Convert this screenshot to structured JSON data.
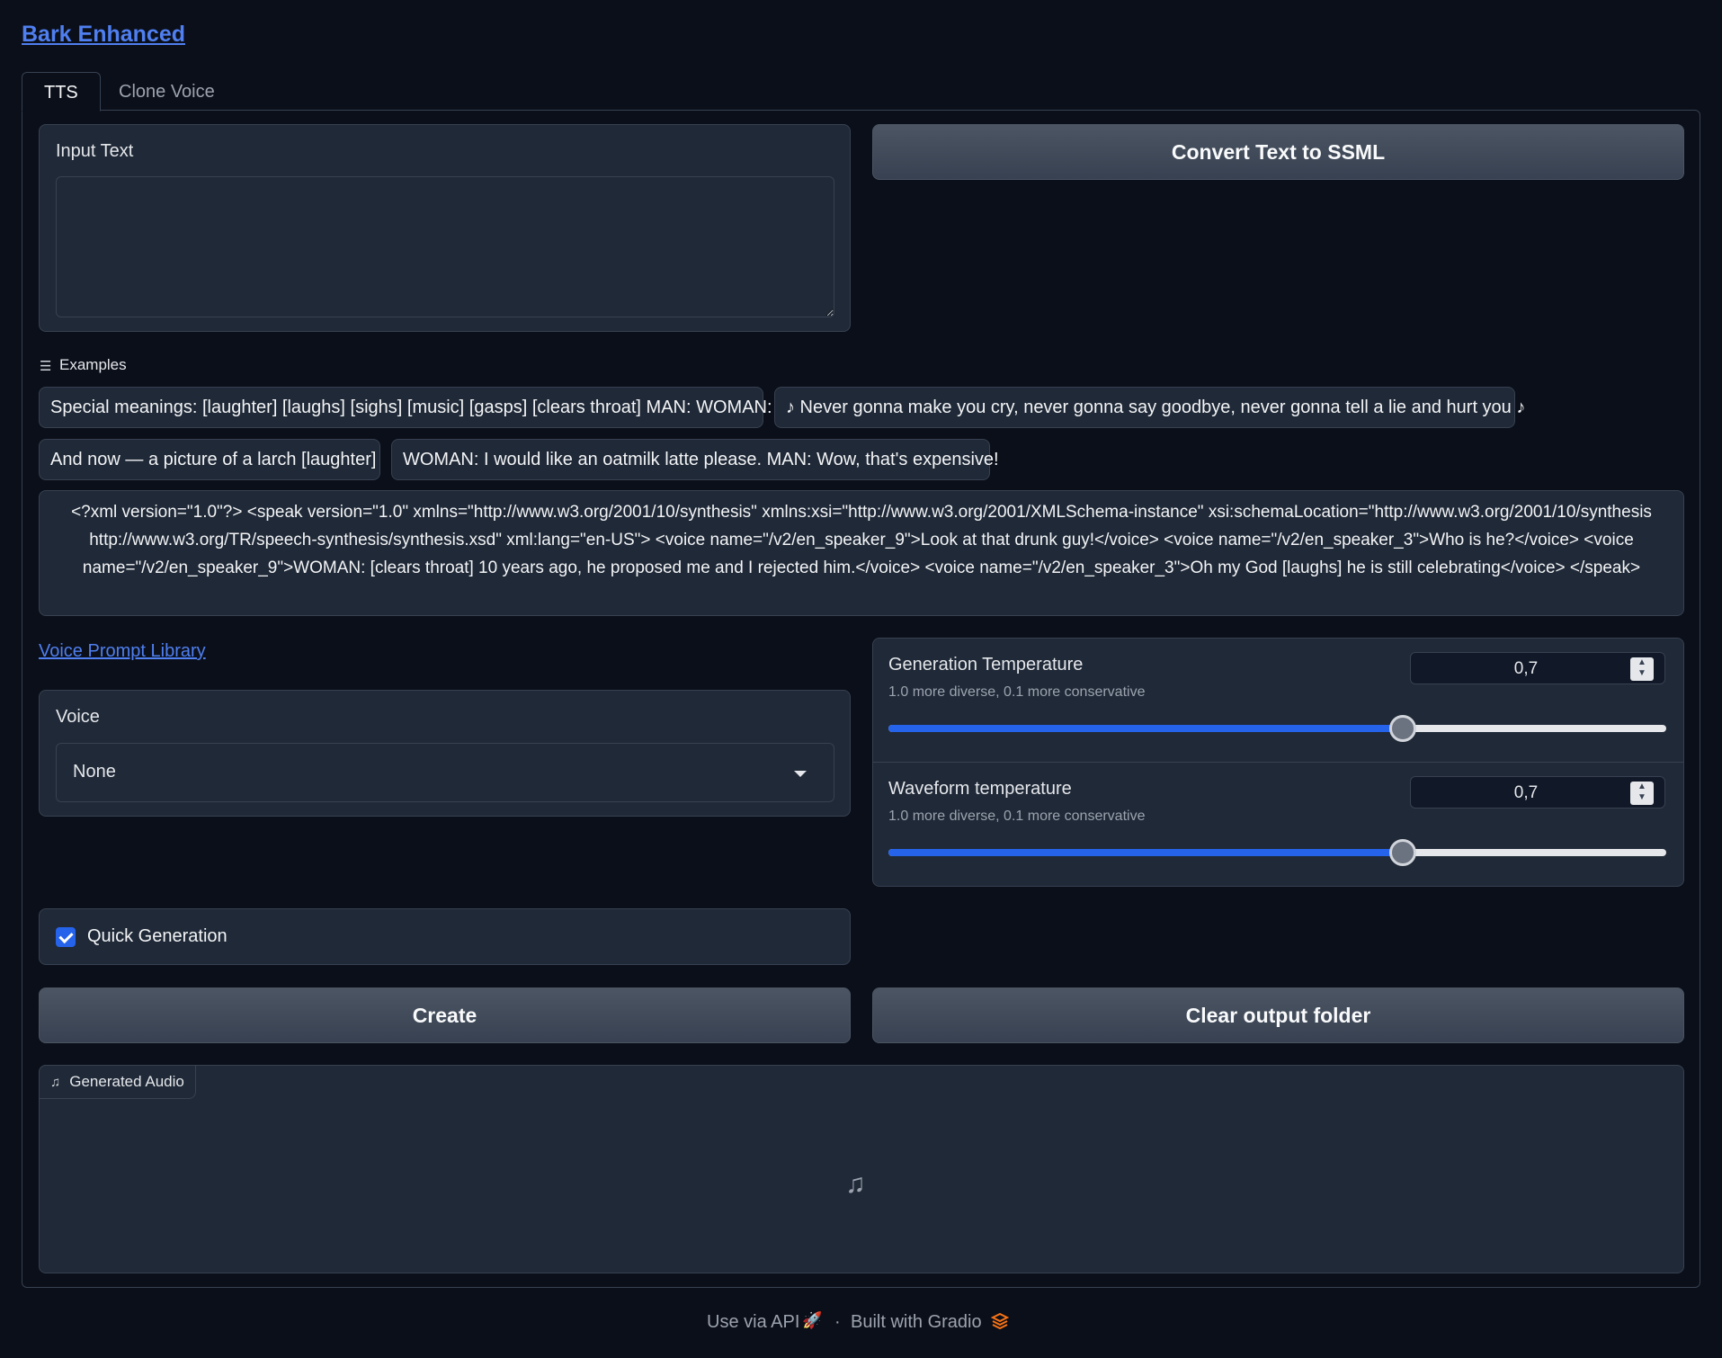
{
  "app": {
    "title": "Bark Enhanced"
  },
  "tabs": [
    {
      "label": "TTS",
      "selected": true
    },
    {
      "label": "Clone Voice",
      "selected": false
    }
  ],
  "input": {
    "label": "Input Text",
    "value": "",
    "placeholder": ""
  },
  "convert_button": "Convert Text to SSML",
  "examples": {
    "label": "Examples",
    "items": [
      "Special meanings: [laughter] [laughs] [sighs] [music] [gasps] [clears throat] MAN: WOMAN:",
      "♪ Never gonna make you cry, never gonna say goodbye, never gonna tell a lie and hurt you ♪",
      "And now — a picture of a larch [laughter]",
      "WOMAN: I would like an oatmilk latte please. MAN: Wow, that's expensive!",
      "<?xml version=\"1.0\"?> <speak version=\"1.0\" xmlns=\"http://www.w3.org/2001/10/synthesis\" xmlns:xsi=\"http://www.w3.org/2001/XMLSchema-instance\" xsi:schemaLocation=\"http://www.w3.org/2001/10/synthesis http://www.w3.org/TR/speech-synthesis/synthesis.xsd\" xml:lang=\"en-US\"> <voice name=\"/v2/en_speaker_9\">Look at that drunk guy!</voice> <voice name=\"/v2/en_speaker_3\">Who is he?</voice> <voice name=\"/v2/en_speaker_9\">WOMAN: [clears throat] 10 years ago, he proposed me and I rejected him.</voice> <voice name=\"/v2/en_speaker_3\">Oh my God [laughs] he is still celebrating</voice> </speak>"
    ]
  },
  "voice": {
    "library_link": "Voice Prompt Library",
    "label": "Voice",
    "selected": "None"
  },
  "sliders": {
    "generation": {
      "label": "Generation Temperature",
      "info": "1.0 more diverse, 0.1 more conservative",
      "value_text": "0,7",
      "fraction": 0.66
    },
    "waveform": {
      "label": "Waveform temperature",
      "info": "1.0 more diverse, 0.1 more conservative",
      "value_text": "0,7",
      "fraction": 0.66
    }
  },
  "quick_generation": {
    "label": "Quick Generation",
    "checked": true
  },
  "buttons": {
    "create": "Create",
    "clear": "Clear output folder"
  },
  "audio": {
    "label": "Generated Audio"
  },
  "footer": {
    "api": "Use via API",
    "separator": "·",
    "built": "Built with Gradio"
  },
  "colors": {
    "accent": "#2563eb",
    "link": "#4f7ff0",
    "background": "#0b0f19",
    "block": "#1f2937",
    "border": "#374151"
  },
  "icons": {
    "examples": "list-icon",
    "audio": "music-note-icon",
    "api": "rocket-icon",
    "gradio": "gradio-logo-icon"
  }
}
